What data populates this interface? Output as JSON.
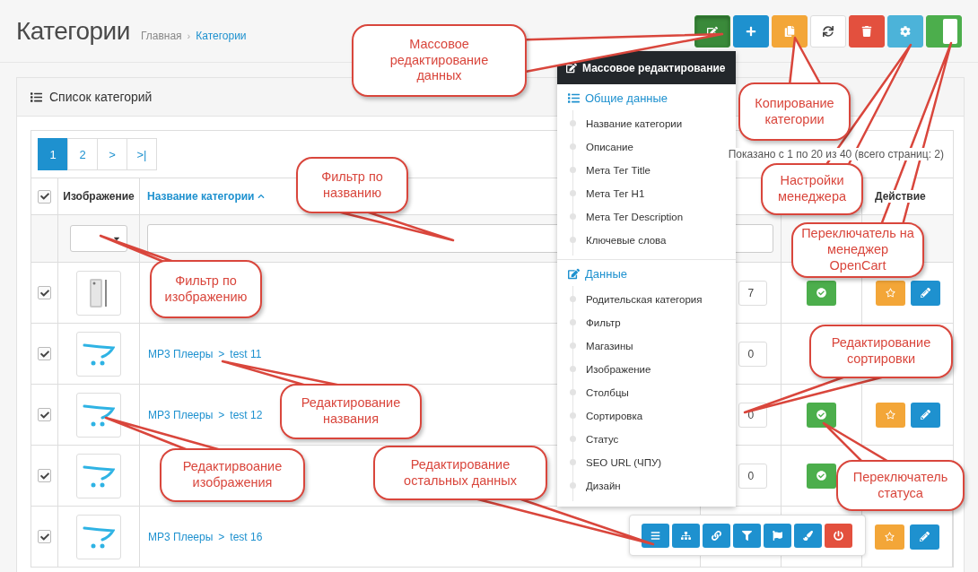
{
  "header": {
    "title": "Категории",
    "separator": "›",
    "breadcrumbs": [
      {
        "label": "Главная",
        "selected": false
      },
      {
        "label": "Категории",
        "selected": true
      }
    ]
  },
  "toolbar": [
    {
      "kind": "edit",
      "selected": true
    },
    {
      "kind": "add",
      "selected": false
    },
    {
      "kind": "copy",
      "selected": false
    },
    {
      "kind": "refresh",
      "selected": false
    },
    {
      "kind": "delete",
      "selected": false
    },
    {
      "kind": "settings",
      "selected": false
    },
    {
      "kind": "toggle",
      "on": true,
      "selected": false
    }
  ],
  "panel": {
    "title": "Список категорий",
    "pagination": [
      {
        "label": "1",
        "selected": true
      },
      {
        "label": "2",
        "selected": false
      },
      {
        "label": ">",
        "selected": false
      },
      {
        "label": ">|",
        "selected": false
      }
    ],
    "summary": "Показано с 1 по 20 из 40 (всего страниц: 2)",
    "table": {
      "all_checked": true,
      "columns": [
        {
          "kind": "plain",
          "label": "Изображение"
        },
        {
          "kind": "sorted",
          "label": "Название категории"
        },
        {
          "kind": "blank"
        },
        {
          "kind": "blank"
        },
        {
          "kind": "plain",
          "label": "Действие"
        }
      ],
      "rows": [
        {
          "kind": "phone",
          "checked": true,
          "sort": "7",
          "status": true,
          "tools": [
            {
              "kind": "star"
            },
            {
              "kind": "edit"
            }
          ]
        },
        {
          "kind": "cart",
          "checked": true,
          "name": {
            "parent": "MP3 Плееры",
            "sep": ">",
            "child": "test 11"
          },
          "sort": "0",
          "tools": []
        },
        {
          "kind": "cart",
          "checked": true,
          "name": {
            "parent": "MP3 Плееры",
            "sep": ">",
            "child": "test 12"
          },
          "sort": "0",
          "status": true,
          "tools": [
            {
              "kind": "star"
            },
            {
              "kind": "edit"
            }
          ]
        },
        {
          "kind": "cart",
          "checked": true,
          "sort": "0",
          "status": true,
          "tools": []
        },
        {
          "kind": "cart",
          "checked": true,
          "name": {
            "parent": "MP3 Плееры",
            "sep": ">",
            "child": "test 16"
          },
          "tools": [
            {
              "kind": "star"
            },
            {
              "kind": "edit"
            }
          ],
          "row_tools": [
            {
              "kind": "menu"
            },
            {
              "kind": "tree"
            },
            {
              "kind": "link"
            },
            {
              "kind": "filter"
            },
            {
              "kind": "flag"
            },
            {
              "kind": "brush"
            },
            {
              "kind": "power"
            }
          ]
        }
      ]
    }
  },
  "menu": {
    "title": "Массовое редактирование",
    "sections": [
      {
        "kind": "list",
        "title": "Общие данные",
        "items": [
          "Название категории",
          "Описание",
          "Мета Тег Title",
          "Мета Тег H1",
          "Мета Тег Description",
          "Ключевые слова"
        ]
      },
      {
        "kind": "edit",
        "title": "Данные",
        "items": [
          "Родительская категория",
          "Фильтр",
          "Магазины",
          "Изображение",
          "Столбцы",
          "Сортировка",
          "Статус",
          "SEO URL (ЧПУ)",
          "Дизайн"
        ]
      }
    ]
  },
  "callouts": [
    "Массовое редактирование данных",
    "Копирование категории",
    "Настройки менеджера",
    "Переключатель на менеджер OpenCart",
    "Фильтр по названию",
    "Фильтр по изображению",
    "Редактирование сортировки",
    "Редактирование названия",
    "Редактирвоание изображения",
    "Редактирование остальных данных",
    "Переключатель статуса"
  ]
}
